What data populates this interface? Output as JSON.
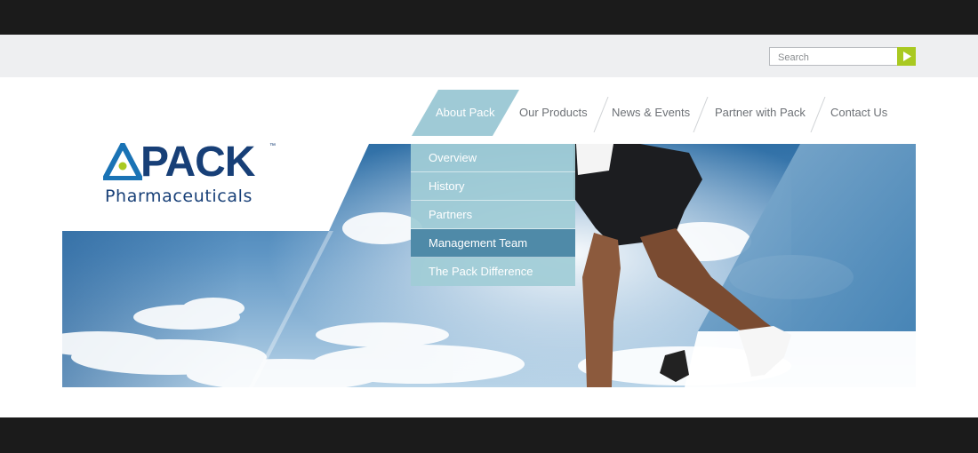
{
  "search": {
    "placeholder": "Search"
  },
  "brand": {
    "name": "PACK",
    "trademark": "™",
    "subtitle": "Pharmaceuticals"
  },
  "nav": {
    "items": [
      {
        "label": "About Pack",
        "active": true
      },
      {
        "label": "Our Products"
      },
      {
        "label": "News & Events"
      },
      {
        "label": "Partner with Pack"
      },
      {
        "label": "Contact Us"
      }
    ]
  },
  "dropdown": {
    "items": [
      {
        "label": "Overview"
      },
      {
        "label": "History"
      },
      {
        "label": "Partners"
      },
      {
        "label": "Management Team",
        "active": true
      },
      {
        "label": "The Pack Difference"
      }
    ]
  },
  "colors": {
    "accent_green": "#a9c921",
    "brand_navy": "#173f77",
    "nav_active": "#9fcad6",
    "dropdown_hover": "#4f8aa8"
  }
}
